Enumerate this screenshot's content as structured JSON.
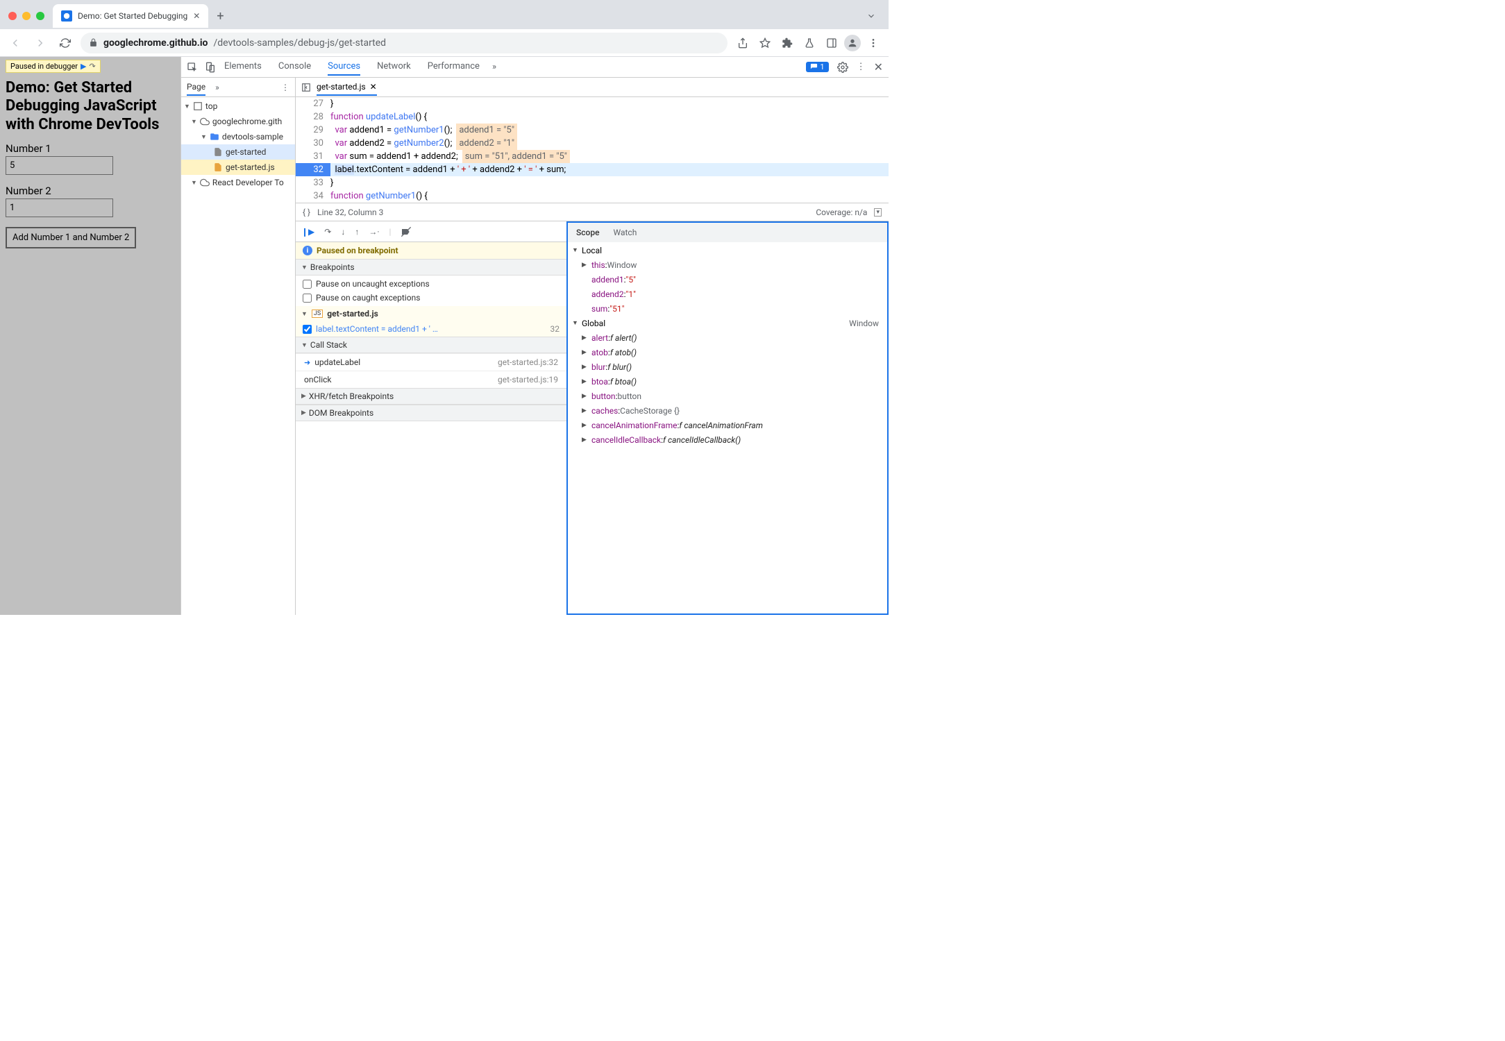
{
  "browser": {
    "tab_title": "Demo: Get Started Debugging",
    "url_host": "googlechrome.github.io",
    "url_path": "/devtools-samples/debug-js/get-started"
  },
  "page": {
    "paused_badge": "Paused in debugger",
    "heading": "Demo: Get Started Debugging JavaScript with Chrome DevTools",
    "label1": "Number 1",
    "input1": "5",
    "label2": "Number 2",
    "input2": "1",
    "button": "Add Number 1 and Number 2"
  },
  "devtools": {
    "tabs": [
      "Elements",
      "Console",
      "Sources",
      "Network",
      "Performance"
    ],
    "active_tab": "Sources",
    "message_count": "1",
    "navigator": {
      "head": "Page",
      "items": [
        {
          "label": "top",
          "icon": "frame",
          "level": 0
        },
        {
          "label": "googlechrome.gith",
          "icon": "cloud",
          "level": 1
        },
        {
          "label": "devtools-sample",
          "icon": "folder",
          "level": 2
        },
        {
          "label": "get-started",
          "icon": "doc",
          "level": 3,
          "selected": true
        },
        {
          "label": "get-started.js",
          "icon": "js",
          "level": 3,
          "active": true
        },
        {
          "label": "React Developer To",
          "icon": "cloud",
          "level": 1
        }
      ]
    },
    "editor": {
      "filename": "get-started.js",
      "status_line": "Line 32, Column 3",
      "coverage": "Coverage: n/a",
      "lines": [
        {
          "n": 27,
          "html": "}"
        },
        {
          "n": 28,
          "html": "<span class='kw'>function</span> <span class='fn'>updateLabel</span>() {"
        },
        {
          "n": 29,
          "html": "  <span class='kw'>var</span> addend1 = <span class='fn'>getNumber1</span>();",
          "hint": "addend1 = \"5\""
        },
        {
          "n": 30,
          "html": "  <span class='kw'>var</span> addend2 = <span class='fn'>getNumber2</span>();",
          "hint": "addend2 = \"1\""
        },
        {
          "n": 31,
          "html": "  <span class='kw'>var</span> sum = addend1 + addend2;",
          "hint": "sum = \"51\", addend1 = \"5\""
        },
        {
          "n": 32,
          "html": "  <span class='sel'>label</span>.textContent = addend1 + <span class='str'>' + '</span> + addend2 + <span class='str'>' = '</span> + sum;",
          "hl": true
        },
        {
          "n": 33,
          "html": "}"
        },
        {
          "n": 34,
          "html": "<span class='kw'>function</span> <span class='fn'>getNumber1</span>() {"
        }
      ]
    },
    "debugger": {
      "paused_msg": "Paused on breakpoint",
      "sections": {
        "breakpoints": "Breakpoints",
        "pause_uncaught": "Pause on uncaught exceptions",
        "pause_caught": "Pause on caught exceptions",
        "bp_file": "get-started.js",
        "bp_line_text": "label.textContent = addend1 + ' …",
        "bp_line_num": "32",
        "callstack": "Call Stack",
        "calls": [
          {
            "name": "updateLabel",
            "loc": "get-started.js:32",
            "current": true
          },
          {
            "name": "onClick",
            "loc": "get-started.js:19"
          }
        ],
        "xhr": "XHR/fetch Breakpoints",
        "dom": "DOM Breakpoints"
      }
    },
    "scope": {
      "tabs": [
        "Scope",
        "Watch"
      ],
      "local_label": "Local",
      "global_label": "Global",
      "global_value": "Window",
      "local": [
        {
          "name": "this",
          "value": "Window",
          "type": "obj",
          "expand": true
        },
        {
          "name": "addend1",
          "value": "\"5\"",
          "type": "str"
        },
        {
          "name": "addend2",
          "value": "\"1\"",
          "type": "str"
        },
        {
          "name": "sum",
          "value": "\"51\"",
          "type": "str"
        }
      ],
      "global": [
        {
          "name": "alert",
          "value": "f alert()",
          "type": "fn"
        },
        {
          "name": "atob",
          "value": "f atob()",
          "type": "fn"
        },
        {
          "name": "blur",
          "value": "f blur()",
          "type": "fn"
        },
        {
          "name": "btoa",
          "value": "f btoa()",
          "type": "fn"
        },
        {
          "name": "button",
          "value": "button",
          "type": "obj"
        },
        {
          "name": "caches",
          "value": "CacheStorage {}",
          "type": "obj"
        },
        {
          "name": "cancelAnimationFrame",
          "value": "f cancelAnimationFram",
          "type": "fn"
        },
        {
          "name": "cancelIdleCallback",
          "value": "f cancelIdleCallback()",
          "type": "fn"
        }
      ]
    }
  }
}
